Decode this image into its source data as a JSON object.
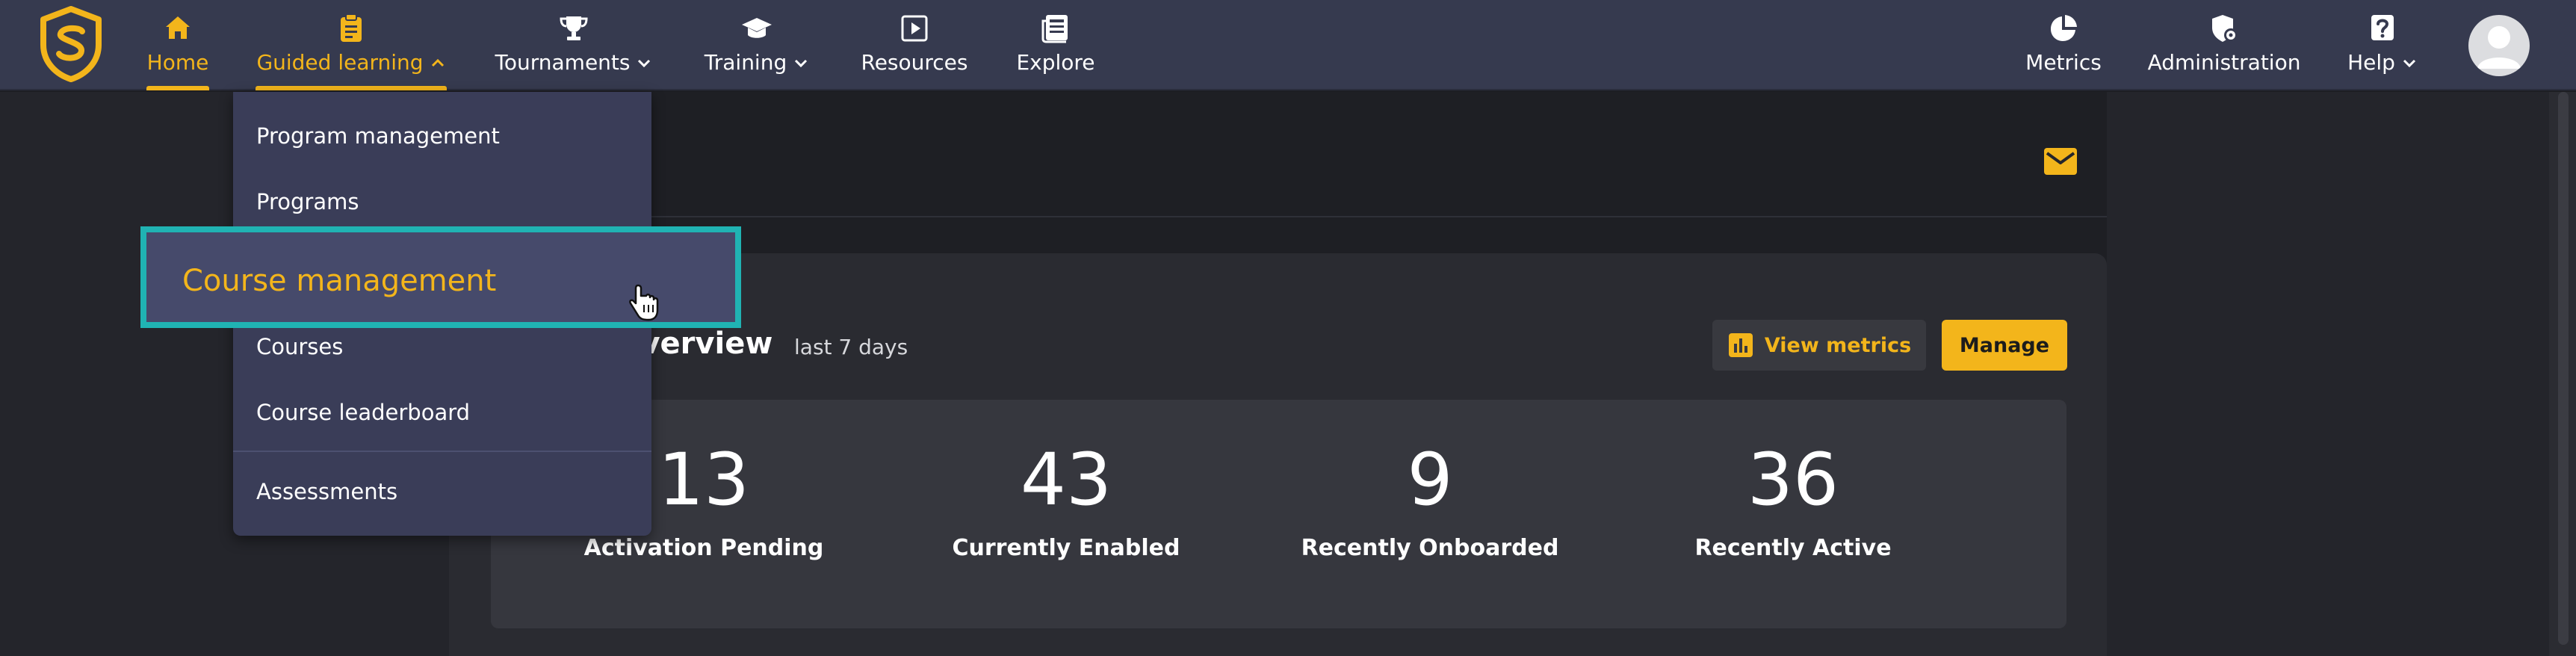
{
  "nav": {
    "items": [
      {
        "id": "home",
        "label": "Home",
        "icon": "home-icon"
      },
      {
        "id": "guided",
        "label": "Guided learning",
        "icon": "clipboard-icon"
      },
      {
        "id": "tournaments",
        "label": "Tournaments",
        "icon": "trophy-icon"
      },
      {
        "id": "training",
        "label": "Training",
        "icon": "graduation-cap-icon"
      },
      {
        "id": "resources",
        "label": "Resources",
        "icon": "play-icon"
      },
      {
        "id": "explore",
        "label": "Explore",
        "icon": "newspaper-icon"
      }
    ],
    "right_items": [
      {
        "id": "metrics",
        "label": "Metrics",
        "icon": "pie-chart-icon"
      },
      {
        "id": "administration",
        "label": "Administration",
        "icon": "shield-gear-icon"
      },
      {
        "id": "help",
        "label": "Help",
        "icon": "question-icon"
      }
    ],
    "active": "home",
    "expanded": "guided"
  },
  "dropdown": {
    "items": [
      "Program management",
      "Programs",
      "Course management",
      "Courses",
      "Course leaderboard",
      "Assessments"
    ],
    "highlighted": "Course management"
  },
  "overview": {
    "title": "overview",
    "subtitle": "last 7 days",
    "view_metrics_label": "View metrics",
    "manage_label": "Manage",
    "stats": [
      {
        "value": "13",
        "label": "Activation Pending"
      },
      {
        "value": "43",
        "label": "Currently Enabled"
      },
      {
        "value": "9",
        "label": "Recently Onboarded"
      },
      {
        "value": "36",
        "label": "Recently Active"
      }
    ]
  },
  "colors": {
    "accent": "#f3b51b",
    "nav_bg": "#363a4f",
    "dropdown_bg": "#3a3d58",
    "highlight_border": "#20b3b3"
  }
}
